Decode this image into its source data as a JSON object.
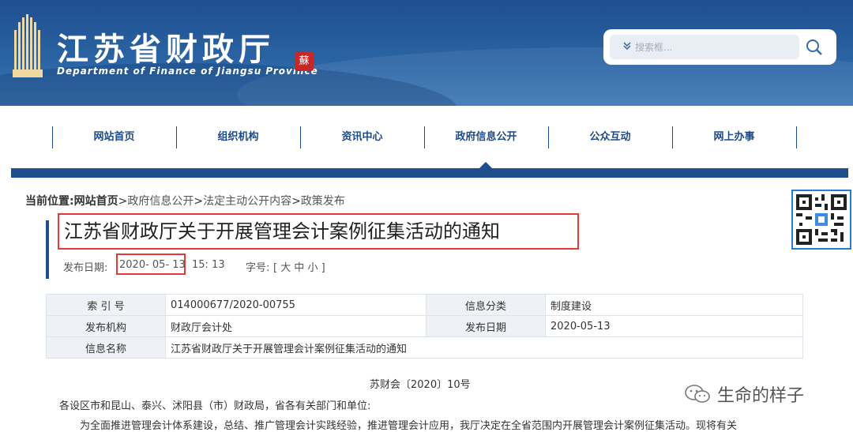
{
  "header": {
    "site_title": "江苏省财政厅",
    "site_subtitle": "Department of Finance of Jiangsu Province",
    "seal_char": "蘇",
    "search": {
      "placeholder": "搜索框..."
    }
  },
  "nav": {
    "items": [
      {
        "label": "网站首页"
      },
      {
        "label": "组织机构"
      },
      {
        "label": "资讯中心"
      },
      {
        "label": "政府信息公开"
      },
      {
        "label": "公众互动"
      },
      {
        "label": "网上办事"
      }
    ],
    "active_index": 3,
    "accent_color": "#1e4e8c"
  },
  "breadcrumb": {
    "prefix": "当前位置:",
    "home": "网站首页",
    "sep": ">",
    "items": [
      "政府信息公开",
      "法定主动公开内容",
      "政策发布"
    ]
  },
  "article": {
    "title": "江苏省财政厅关于开展管理会计案例征集活动的通知",
    "meta": {
      "date_label": "发布日期:",
      "date": "2020- 05- 13",
      "time": "15: 13",
      "font_label": "字号:",
      "font_sizes": "[ 大 中 小 ]"
    },
    "info": {
      "rows": [
        {
          "k1": "索 引 号",
          "v1": "014000677/2020-00755",
          "k2": "信息分类",
          "v2": "制度建设"
        },
        {
          "k1": "发布机构",
          "v1": "财政厅会计处",
          "k2": "发布日期",
          "v2": "2020-05-13"
        }
      ],
      "name_row": {
        "k": "信息名称",
        "v": "江苏省财政厅关于开展管理会计案例征集活动的通知"
      }
    },
    "doc_no": "苏财会〔2020〕10号",
    "para1": "各设区市和昆山、泰兴、沭阳县（市）财政局，省各有关部门和单位:",
    "para2": "为全面推进管理会计体系建设，总结、推广管理会计实践经验，推进管理会计应用，我厅决定在全省范围内开展管理会计案例征集活动。现将有关"
  },
  "watermark": {
    "text": "生命的样子"
  },
  "colors": {
    "alert_red": "#e53935",
    "banner_blue": "#2a63a3"
  }
}
